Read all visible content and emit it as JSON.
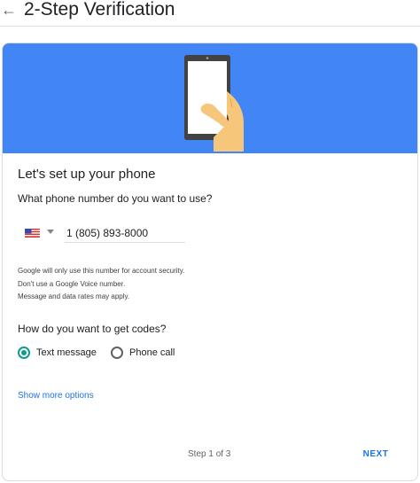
{
  "header": {
    "back_icon": "arrow-left-icon",
    "title": "2-Step Verification"
  },
  "colors": {
    "banner": "#4285f4",
    "accent": "#1a73e8",
    "radio_selected": "#0f9d8a"
  },
  "banner": {
    "illustration": "hand-holding-phone-icon"
  },
  "setup": {
    "heading": "Let's set up your phone",
    "phone_question": "What phone number do you want to use?",
    "country_icon": "us-flag-icon",
    "phone_value": "1 (805) 893-8000",
    "notes": [
      "Google will only use this number for account security.",
      "Don't use a Google Voice number.",
      "Message and data rates may apply."
    ],
    "codes_question": "How do you want to get codes?",
    "options": [
      {
        "label": "Text message",
        "selected": true
      },
      {
        "label": "Phone call",
        "selected": false
      }
    ],
    "more_options": "Show more options"
  },
  "footer": {
    "step": "Step 1 of 3",
    "next": "NEXT"
  }
}
